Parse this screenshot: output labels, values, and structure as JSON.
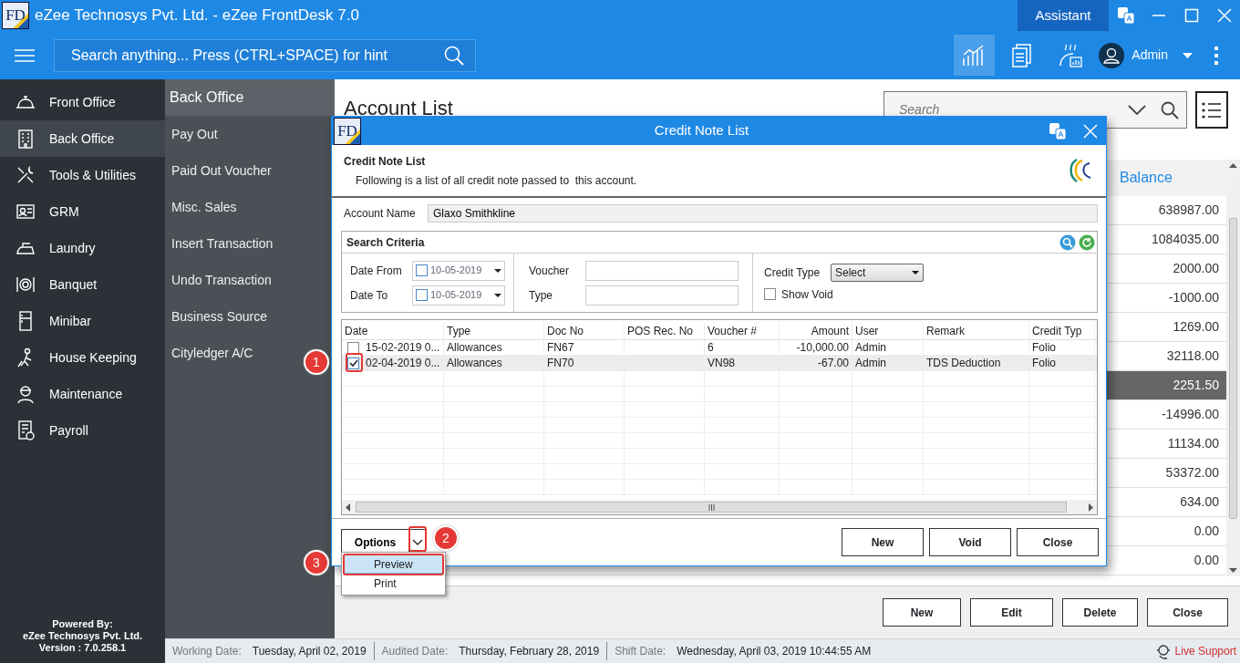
{
  "window": {
    "logo": "FD",
    "title": "eZee Technosys Pvt. Ltd. - eZee FrontDesk 7.0",
    "assistant": "Assistant"
  },
  "toolbar": {
    "search": {
      "placeholder": "Search anything... Press (CTRL+SPACE) for hint"
    },
    "tools": [
      {
        "kind": "chart",
        "selected": true
      },
      {
        "kind": "documents",
        "selected": false
      },
      {
        "kind": "reports",
        "selected": false
      }
    ],
    "user": "Admin"
  },
  "sidebar": {
    "items": [
      {
        "label": "Front Office",
        "selected": false
      },
      {
        "label": "Back Office",
        "selected": true
      },
      {
        "label": "Tools & Utilities",
        "selected": false
      },
      {
        "label": "GRM",
        "selected": false
      },
      {
        "label": "Laundry",
        "selected": false
      },
      {
        "label": "Banquet",
        "selected": false
      },
      {
        "label": "Minibar",
        "selected": false
      },
      {
        "label": "House Keeping",
        "selected": false
      },
      {
        "label": "Maintenance",
        "selected": false
      },
      {
        "label": "Payroll",
        "selected": false
      }
    ],
    "footer": [
      "Powered By:",
      "eZee Technosys Pvt. Ltd.",
      "Version : 7.0.258.1"
    ]
  },
  "submenu": {
    "title": "Back Office",
    "items": [
      "Pay Out",
      "Paid Out Voucher",
      "Misc. Sales",
      "Insert Transaction",
      "Undo Transaction",
      "Business Source",
      "Cityledger A/C"
    ]
  },
  "account_list": {
    "title": "Account List",
    "search": {
      "placeholder": "Search"
    },
    "table": {
      "columns": [
        "Balance"
      ],
      "rows": [
        {
          "balance": "638987.00",
          "selected": false
        },
        {
          "balance": "1084035.00",
          "selected": false
        },
        {
          "balance": "2000.00",
          "selected": false
        },
        {
          "balance": "-1000.00",
          "selected": false
        },
        {
          "balance": "1269.00",
          "selected": false
        },
        {
          "balance": "32118.00",
          "selected": false
        },
        {
          "balance": "2251.50",
          "selected": true
        },
        {
          "balance": "-14996.00",
          "selected": false
        },
        {
          "balance": "11134.00",
          "selected": false
        },
        {
          "balance": "53372.00",
          "selected": false
        },
        {
          "balance": "634.00",
          "selected": false
        },
        {
          "balance": "0.00",
          "selected": false
        },
        {
          "balance": "0.00",
          "selected": false
        }
      ]
    },
    "buttons": [
      "New",
      "Edit",
      "Delete",
      "Close"
    ]
  },
  "status_bar": {
    "items": [
      {
        "label": "Working Date:",
        "value": "Tuesday, April 02, 2019"
      },
      {
        "label": "Audited Date:",
        "value": "Thursday, February 28, 2019"
      },
      {
        "label": "Shift Date:",
        "value": "Wednesday, April 03, 2019 10:44:55 AM"
      }
    ],
    "live_support": "Live Support"
  },
  "dialog": {
    "logo": "FD",
    "title": "Credit Note List",
    "header": {
      "title": "Credit Note List",
      "subtitle": "Following is a list of all credit note passed to  this account."
    },
    "account_name": {
      "label": "Account Name",
      "value": "Glaxo Smithkline"
    },
    "search_criteria": {
      "title": "Search Criteria",
      "date_from": {
        "label": "Date From",
        "value": "10-05-2019",
        "checked": false
      },
      "date_to": {
        "label": "Date To",
        "value": "10-05-2019",
        "checked": false
      },
      "voucher": {
        "label": "Voucher"
      },
      "type": {
        "label": "Type"
      },
      "credit_type": {
        "label": "Credit Type",
        "value": "Select"
      },
      "show_void": {
        "label": "Show Void",
        "checked": false
      }
    },
    "grid": {
      "columns": [
        "Date",
        "Type",
        "Doc No",
        "POS Rec. No",
        "Voucher #",
        "Amount",
        "User",
        "Remark",
        "Credit Typ"
      ],
      "rows": [
        {
          "checked": false,
          "selected": false,
          "cells": [
            "15-02-2019 0...",
            "Allowances",
            "FN67",
            "",
            "6",
            "-10,000.00",
            "Admin",
            "",
            "Folio"
          ]
        },
        {
          "checked": true,
          "selected": true,
          "cells": [
            "02-04-2019 0...",
            "Allowances",
            "FN70",
            "",
            "VN98",
            "-67.00",
            "Admin",
            "TDS Deduction",
            "Folio"
          ]
        }
      ]
    },
    "options": "Options",
    "menu": [
      {
        "label": "Preview",
        "selected": true
      },
      {
        "label": "Print",
        "selected": false
      }
    ],
    "buttons": [
      "New",
      "Void",
      "Close"
    ]
  },
  "callouts": [
    "1",
    "2",
    "3"
  ]
}
